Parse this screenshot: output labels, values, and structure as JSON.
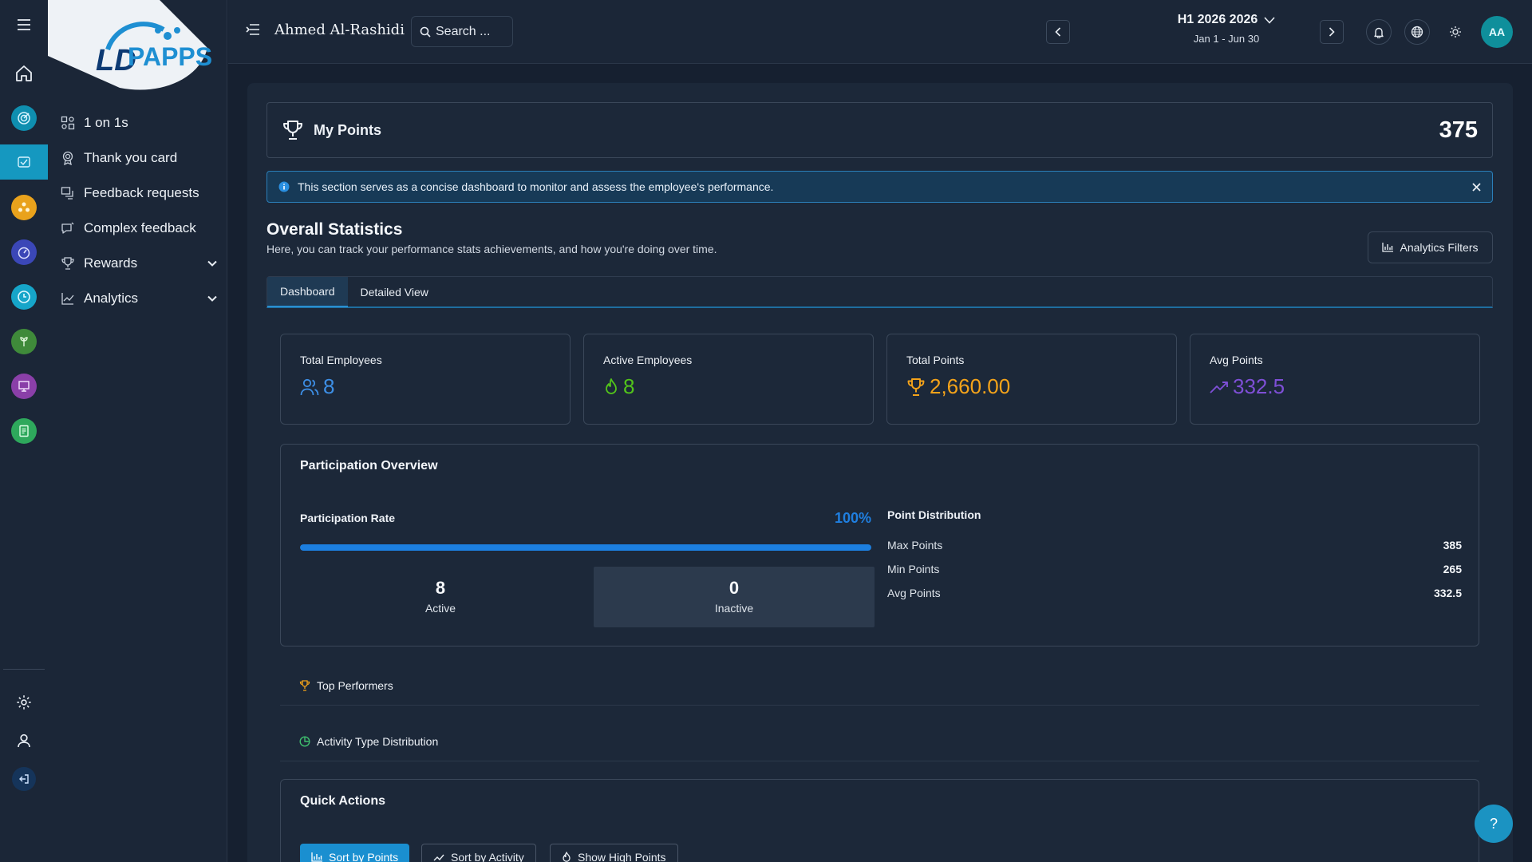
{
  "brand": {
    "logo_text": "PAPPS",
    "logo_prefix": "LD"
  },
  "rail": {
    "icons": [
      "menu-icon",
      "home-icon",
      "target-icon",
      "handshake-icon",
      "people-icon",
      "speedometer-icon",
      "clock-icon",
      "plant-icon",
      "presentation-icon",
      "document-icon",
      "gear-icon",
      "user-icon",
      "logout-icon"
    ],
    "colors": {
      "teal": "#0f8fb0",
      "orange": "#e9a21c",
      "indigo": "#3b47b7",
      "cyan": "#16a5c9",
      "green": "#3f8a3a",
      "purple": "#8a3fa8",
      "emerald": "#2ea85c"
    }
  },
  "sidebar": {
    "items": [
      {
        "label": "1 on 1s",
        "icon": "people-grid-icon"
      },
      {
        "label": "Thank you card",
        "icon": "medal-icon"
      },
      {
        "label": "Feedback requests",
        "icon": "feedback-icon"
      },
      {
        "label": "Complex feedback",
        "icon": "chat-icon"
      },
      {
        "label": "Rewards",
        "icon": "trophy-icon",
        "expandable": true
      },
      {
        "label": "Analytics",
        "icon": "chart-line-icon",
        "expandable": true
      }
    ]
  },
  "header": {
    "user_name": "Ahmed Al-Rashidi",
    "search_placeholder": "Search ...",
    "period_title": "H1 2026 2026",
    "period_range": "Jan 1 - Jun 30",
    "avatar_initials": "AA"
  },
  "my_points": {
    "label": "My Points",
    "value": "375"
  },
  "alert": {
    "text": "This section serves as a concise dashboard to monitor and assess the employee's performance."
  },
  "overall": {
    "title": "Overall Statistics",
    "subtitle": "Here, you can track your performance stats achievements, and how you're doing over time.",
    "filters_label": "Analytics Filters"
  },
  "tabs": [
    {
      "label": "Dashboard",
      "active": true
    },
    {
      "label": "Detailed View",
      "active": false
    }
  ],
  "stats": [
    {
      "label": "Total Employees",
      "value": "8",
      "icon": "users-icon",
      "color": "#3d8fe6"
    },
    {
      "label": "Active Employees",
      "value": "8",
      "icon": "flame-icon",
      "color": "#52c41a"
    },
    {
      "label": "Total Points",
      "value": "2,660.00",
      "icon": "trophy-icon",
      "color": "#f4a31a"
    },
    {
      "label": "Avg Points",
      "value": "332.5",
      "icon": "trend-up-icon",
      "color": "#7e4fd6"
    }
  ],
  "participation": {
    "title": "Participation Overview",
    "rate_label": "Participation Rate",
    "rate_text": "100%",
    "rate_fraction": 1.0,
    "active_count": "8",
    "active_label": "Active",
    "inactive_count": "0",
    "inactive_label": "Inactive",
    "distribution_title": "Point Distribution",
    "distribution": [
      {
        "label": "Max Points",
        "value": "385"
      },
      {
        "label": "Min Points",
        "value": "265"
      },
      {
        "label": "Avg Points",
        "value": "332.5"
      }
    ]
  },
  "collapsibles": [
    {
      "label": "Top Performers",
      "icon": "trophy-icon",
      "color": "#f4a31a"
    },
    {
      "label": "Activity Type Distribution",
      "icon": "pie-chart-icon",
      "color": "#3fbf6e"
    }
  ],
  "quick_actions": {
    "title": "Quick Actions",
    "buttons": [
      {
        "label": "Sort by Points",
        "icon": "bar-chart-icon",
        "primary": true
      },
      {
        "label": "Sort by Activity",
        "icon": "trend-up-icon",
        "primary": false
      },
      {
        "label": "Show High Points",
        "icon": "flame-icon",
        "primary": false
      }
    ]
  },
  "help": {
    "label": "?"
  }
}
